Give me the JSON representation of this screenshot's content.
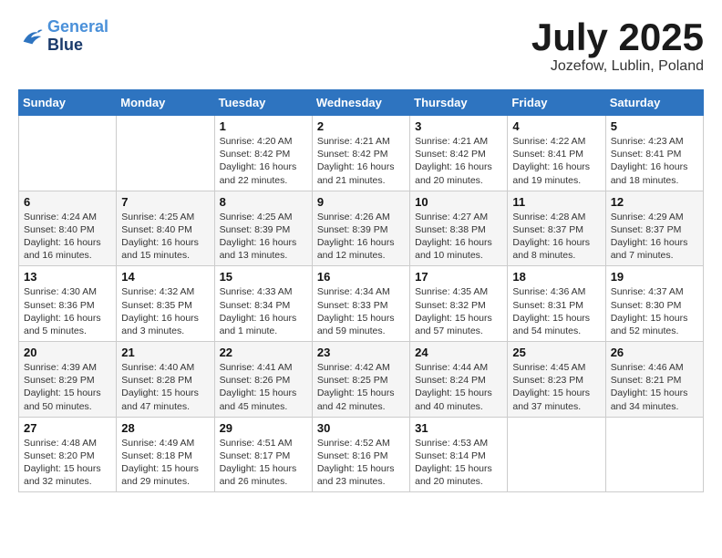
{
  "logo": {
    "line1": "General",
    "line2": "Blue"
  },
  "title": "July 2025",
  "location": "Jozefow, Lublin, Poland",
  "days_of_week": [
    "Sunday",
    "Monday",
    "Tuesday",
    "Wednesday",
    "Thursday",
    "Friday",
    "Saturday"
  ],
  "weeks": [
    [
      {
        "day": "",
        "info": ""
      },
      {
        "day": "",
        "info": ""
      },
      {
        "day": "1",
        "info": "Sunrise: 4:20 AM\nSunset: 8:42 PM\nDaylight: 16 hours\nand 22 minutes."
      },
      {
        "day": "2",
        "info": "Sunrise: 4:21 AM\nSunset: 8:42 PM\nDaylight: 16 hours\nand 21 minutes."
      },
      {
        "day": "3",
        "info": "Sunrise: 4:21 AM\nSunset: 8:42 PM\nDaylight: 16 hours\nand 20 minutes."
      },
      {
        "day": "4",
        "info": "Sunrise: 4:22 AM\nSunset: 8:41 PM\nDaylight: 16 hours\nand 19 minutes."
      },
      {
        "day": "5",
        "info": "Sunrise: 4:23 AM\nSunset: 8:41 PM\nDaylight: 16 hours\nand 18 minutes."
      }
    ],
    [
      {
        "day": "6",
        "info": "Sunrise: 4:24 AM\nSunset: 8:40 PM\nDaylight: 16 hours\nand 16 minutes."
      },
      {
        "day": "7",
        "info": "Sunrise: 4:25 AM\nSunset: 8:40 PM\nDaylight: 16 hours\nand 15 minutes."
      },
      {
        "day": "8",
        "info": "Sunrise: 4:25 AM\nSunset: 8:39 PM\nDaylight: 16 hours\nand 13 minutes."
      },
      {
        "day": "9",
        "info": "Sunrise: 4:26 AM\nSunset: 8:39 PM\nDaylight: 16 hours\nand 12 minutes."
      },
      {
        "day": "10",
        "info": "Sunrise: 4:27 AM\nSunset: 8:38 PM\nDaylight: 16 hours\nand 10 minutes."
      },
      {
        "day": "11",
        "info": "Sunrise: 4:28 AM\nSunset: 8:37 PM\nDaylight: 16 hours\nand 8 minutes."
      },
      {
        "day": "12",
        "info": "Sunrise: 4:29 AM\nSunset: 8:37 PM\nDaylight: 16 hours\nand 7 minutes."
      }
    ],
    [
      {
        "day": "13",
        "info": "Sunrise: 4:30 AM\nSunset: 8:36 PM\nDaylight: 16 hours\nand 5 minutes."
      },
      {
        "day": "14",
        "info": "Sunrise: 4:32 AM\nSunset: 8:35 PM\nDaylight: 16 hours\nand 3 minutes."
      },
      {
        "day": "15",
        "info": "Sunrise: 4:33 AM\nSunset: 8:34 PM\nDaylight: 16 hours\nand 1 minute."
      },
      {
        "day": "16",
        "info": "Sunrise: 4:34 AM\nSunset: 8:33 PM\nDaylight: 15 hours\nand 59 minutes."
      },
      {
        "day": "17",
        "info": "Sunrise: 4:35 AM\nSunset: 8:32 PM\nDaylight: 15 hours\nand 57 minutes."
      },
      {
        "day": "18",
        "info": "Sunrise: 4:36 AM\nSunset: 8:31 PM\nDaylight: 15 hours\nand 54 minutes."
      },
      {
        "day": "19",
        "info": "Sunrise: 4:37 AM\nSunset: 8:30 PM\nDaylight: 15 hours\nand 52 minutes."
      }
    ],
    [
      {
        "day": "20",
        "info": "Sunrise: 4:39 AM\nSunset: 8:29 PM\nDaylight: 15 hours\nand 50 minutes."
      },
      {
        "day": "21",
        "info": "Sunrise: 4:40 AM\nSunset: 8:28 PM\nDaylight: 15 hours\nand 47 minutes."
      },
      {
        "day": "22",
        "info": "Sunrise: 4:41 AM\nSunset: 8:26 PM\nDaylight: 15 hours\nand 45 minutes."
      },
      {
        "day": "23",
        "info": "Sunrise: 4:42 AM\nSunset: 8:25 PM\nDaylight: 15 hours\nand 42 minutes."
      },
      {
        "day": "24",
        "info": "Sunrise: 4:44 AM\nSunset: 8:24 PM\nDaylight: 15 hours\nand 40 minutes."
      },
      {
        "day": "25",
        "info": "Sunrise: 4:45 AM\nSunset: 8:23 PM\nDaylight: 15 hours\nand 37 minutes."
      },
      {
        "day": "26",
        "info": "Sunrise: 4:46 AM\nSunset: 8:21 PM\nDaylight: 15 hours\nand 34 minutes."
      }
    ],
    [
      {
        "day": "27",
        "info": "Sunrise: 4:48 AM\nSunset: 8:20 PM\nDaylight: 15 hours\nand 32 minutes."
      },
      {
        "day": "28",
        "info": "Sunrise: 4:49 AM\nSunset: 8:18 PM\nDaylight: 15 hours\nand 29 minutes."
      },
      {
        "day": "29",
        "info": "Sunrise: 4:51 AM\nSunset: 8:17 PM\nDaylight: 15 hours\nand 26 minutes."
      },
      {
        "day": "30",
        "info": "Sunrise: 4:52 AM\nSunset: 8:16 PM\nDaylight: 15 hours\nand 23 minutes."
      },
      {
        "day": "31",
        "info": "Sunrise: 4:53 AM\nSunset: 8:14 PM\nDaylight: 15 hours\nand 20 minutes."
      },
      {
        "day": "",
        "info": ""
      },
      {
        "day": "",
        "info": ""
      }
    ]
  ]
}
